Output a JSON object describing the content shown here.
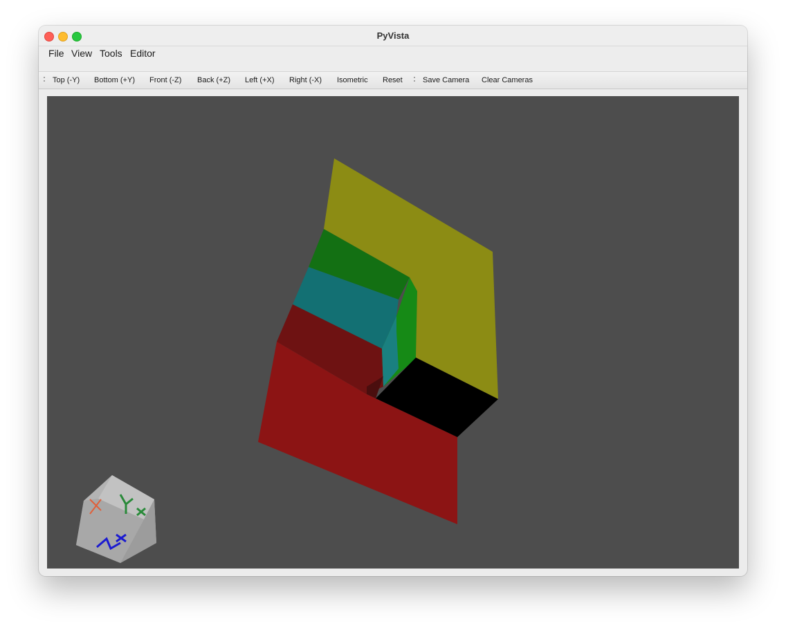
{
  "window": {
    "title": "PyVista"
  },
  "menubar": {
    "items": [
      "File",
      "View",
      "Tools",
      "Editor"
    ]
  },
  "toolbar": {
    "views": [
      "Top (-Y)",
      "Bottom (+Y)",
      "Front (-Z)",
      "Back (+Z)",
      "Left (+X)",
      "Right (-X)",
      "Isometric",
      "Reset"
    ],
    "camera": [
      "Save Camera",
      "Clear Cameras"
    ]
  },
  "viewport": {
    "background": "#4d4d4d",
    "mesh_colors": {
      "top": "#8c8c14",
      "green": "#137013",
      "cyan": "#137073",
      "red": "#8c1414",
      "dark": "#000000"
    },
    "orientation_cube": {
      "labels": [
        "X",
        "Y",
        "Z"
      ],
      "x_color": "#e0603a",
      "y_color": "#2a8a3a",
      "z_color": "#1a1ad0"
    }
  }
}
